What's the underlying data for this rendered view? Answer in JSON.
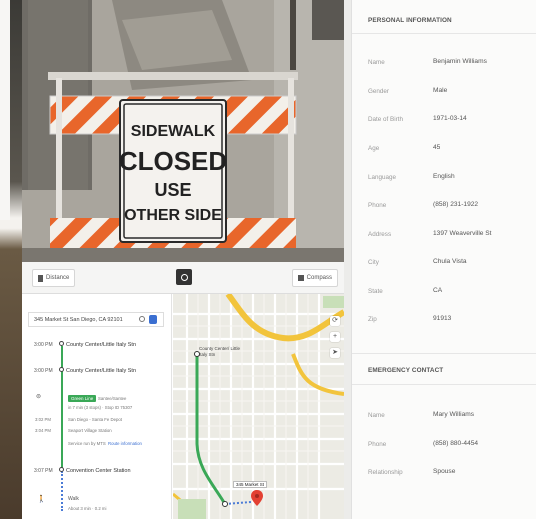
{
  "camera": {
    "sign": {
      "line1": "SIDEWALK",
      "line2": "CLOSED",
      "line3": "USE",
      "line4": "OTHER SIDE"
    }
  },
  "toolbar": {
    "distance_label": "Distance",
    "compass_label": "Compass"
  },
  "map": {
    "search_value": "345 Market St San Diego, CA 92101",
    "steps": [
      {
        "time": "3:00 PM",
        "name": "County Center/Little Italy Stn"
      },
      {
        "time": "3:00 PM",
        "name": "County Center/Little Italy Stn"
      }
    ],
    "line_badge": "Green Line",
    "line_dest": "Santee/Santee",
    "line_detail": "in 7 min (3 stops) · Stop ID 75307",
    "sub_stops": [
      {
        "time": "3:02 PM",
        "name": "San Diego - Santa Fe Depot"
      },
      {
        "time": "3:04 PM",
        "name": "Seaport Village Station"
      }
    ],
    "service_note": "Service run by MTS",
    "route_info": "Route information",
    "arrival": {
      "time": "3:07 PM",
      "name": "Convention Center Station"
    },
    "walk_label": "Walk",
    "walk_detail": "About 3 min · 0.2 mi",
    "labels": {
      "stn": "County Center/ Little Italy Stn",
      "dest": "345 Market St"
    }
  },
  "personal": {
    "heading": "PERSONAL INFORMATION",
    "rows": [
      {
        "label": "Name",
        "value": "Benjamin Williams"
      },
      {
        "label": "Gender",
        "value": "Male"
      },
      {
        "label": "Date of Birth",
        "value": "1971-03-14"
      },
      {
        "label": "Age",
        "value": "45"
      },
      {
        "label": "Language",
        "value": "English"
      },
      {
        "label": "Phone",
        "value": "(858) 231-1922"
      },
      {
        "label": "Address",
        "value": "1397 Weaverville St"
      },
      {
        "label": "City",
        "value": "Chula Vista"
      },
      {
        "label": "State",
        "value": "CA"
      },
      {
        "label": "Zip",
        "value": "91913"
      }
    ]
  },
  "emergency": {
    "heading": "EMERGENCY CONTACT",
    "rows": [
      {
        "label": "Name",
        "value": "Mary Williams"
      },
      {
        "label": "Phone",
        "value": "(858) 880-4454"
      },
      {
        "label": "Relationship",
        "value": "Spouse"
      }
    ]
  },
  "colors": {
    "transit_green": "#3aa857",
    "walk_blue": "#4b7bd6",
    "barrier_orange": "#e8662b",
    "freeway_yellow": "#f2c43c"
  }
}
